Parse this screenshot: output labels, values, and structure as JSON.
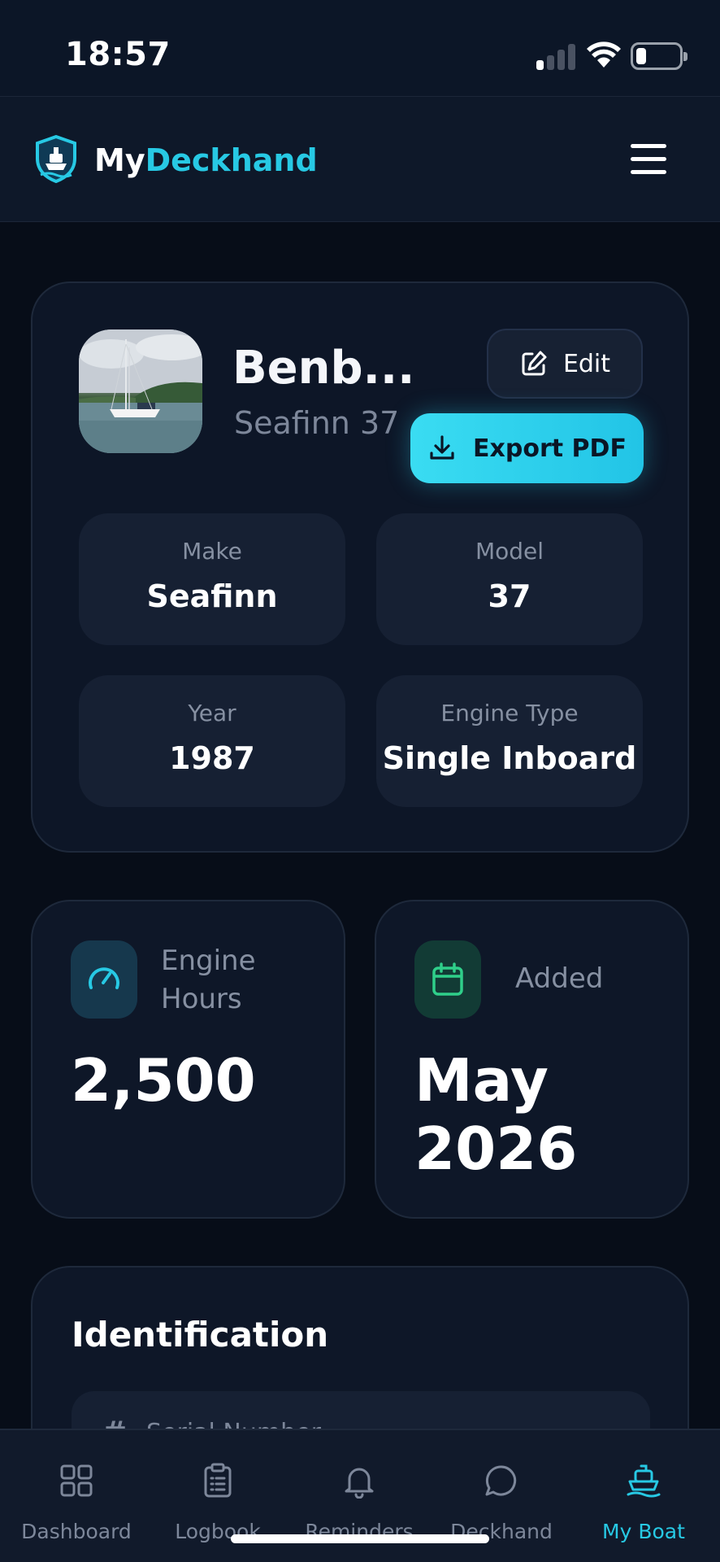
{
  "status_bar": {
    "time": "18:57"
  },
  "header": {
    "brand_part1": "My",
    "brand_part2": "Deckhand",
    "logo_icon": "ship-shield-icon",
    "menu_icon": "hamburger-menu-icon"
  },
  "boat": {
    "name": "Benb...",
    "subtitle": "Seafinn 37",
    "edit_label": "Edit",
    "export_label": "Export PDF",
    "specs": [
      {
        "label": "Make",
        "value": "Seafinn"
      },
      {
        "label": "Model",
        "value": "37"
      },
      {
        "label": "Year",
        "value": "1987"
      },
      {
        "label": "Engine Type",
        "value": "Single Inboard"
      }
    ]
  },
  "stats": {
    "engine_hours": {
      "label_line1": "Engine",
      "label_line2": "Hours",
      "value": "2,500",
      "icon": "gauge-icon"
    },
    "added": {
      "label": "Added",
      "value_line1": "May",
      "value_line2": "2026",
      "icon": "calendar-icon"
    }
  },
  "identification": {
    "title": "Identification",
    "first_row_label": "Serial Number"
  },
  "tabs": [
    {
      "label": "Dashboard",
      "icon": "grid-icon"
    },
    {
      "label": "Logbook",
      "icon": "clipboard-icon"
    },
    {
      "label": "Reminders",
      "icon": "bell-icon"
    },
    {
      "label": "Deckhand",
      "icon": "chat-bubble-icon"
    },
    {
      "label": "My Boat",
      "icon": "boat-icon",
      "active": true
    }
  ],
  "colors": {
    "accent": "#27c9e4",
    "background": "#070d18",
    "card": "#0e1728",
    "muted_text": "#8690a2",
    "green_accent": "#2fcf8a"
  }
}
